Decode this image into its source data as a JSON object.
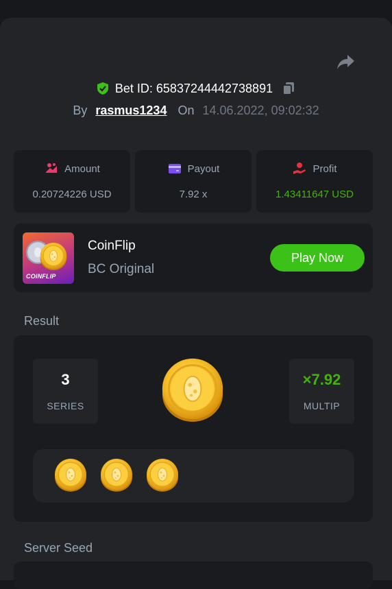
{
  "bet": {
    "id_label": "Bet ID: 65837244442738891",
    "by_label": "By",
    "user": "rasmus1234",
    "on_label": "On",
    "date": "14.06.2022, 09:02:32"
  },
  "stats": {
    "amount": {
      "label": "Amount",
      "value": "0.20724226 USD"
    },
    "payout": {
      "label": "Payout",
      "value": "7.92 x"
    },
    "profit": {
      "label": "Profit",
      "value": "1.43411647 USD"
    }
  },
  "game": {
    "thumb_text": "COINFLIP",
    "title": "CoinFlip",
    "subtitle": "BC Original",
    "play_label": "Play Now"
  },
  "result": {
    "section_label": "Result",
    "series_value": "3",
    "series_label": "SERIES",
    "multiplier_value": "×7.92",
    "multiplier_label": "MULTIP",
    "coin_count": 3
  },
  "server_seed": {
    "label": "Server Seed"
  },
  "colors": {
    "accent_green": "#3bc117",
    "profit_green": "#43b309",
    "muted_text": "#98a7b5",
    "panel_bg": "#232427",
    "card_bg": "#1a1b1e"
  },
  "icons": [
    "share-icon",
    "verified-shield-icon",
    "copy-icon",
    "amount-icon",
    "payout-card-icon",
    "profit-icon",
    "gold-coin-icon"
  ]
}
